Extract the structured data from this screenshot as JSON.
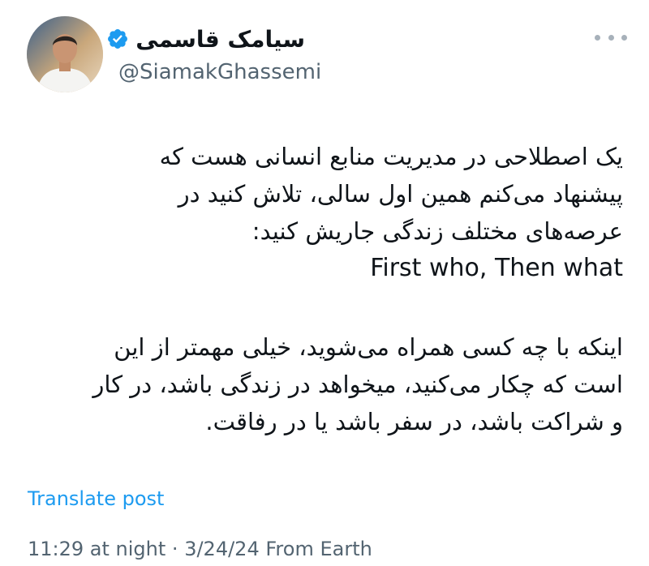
{
  "author": {
    "display_name": "سیامک قاسمی",
    "handle": "@SiamakGhassemi",
    "verified": true,
    "verified_color": "#1d9bf0"
  },
  "more_menu": {
    "icon": "more-horizontal-icon"
  },
  "tweet": {
    "paragraph1": [
      "یک اصطلاحی در مدیریت منابع انسانی هست که",
      "پیشنهاد می‌کنم همین اول سالی، تلاش کنید در",
      "عرصه‌های مختلف زندگی جاریش کنید:",
      "First who, Then what"
    ],
    "paragraph2": [
      "اینکه با چه کسی همراه می‌شوید، خیلی مهمتر از این",
      "است که چکار می‌کنید، میخواهد در زندگی باشد، در کار",
      "و شراکت باشد، در سفر باشد یا در رفاقت."
    ]
  },
  "translate_label": "Translate post",
  "meta": {
    "time": "11:29 at night",
    "separator": "·",
    "date": "3/24/24",
    "source": "From Earth"
  },
  "colors": {
    "link": "#1d9bf0",
    "secondary_text": "#536471",
    "primary_text": "#0f1419"
  }
}
